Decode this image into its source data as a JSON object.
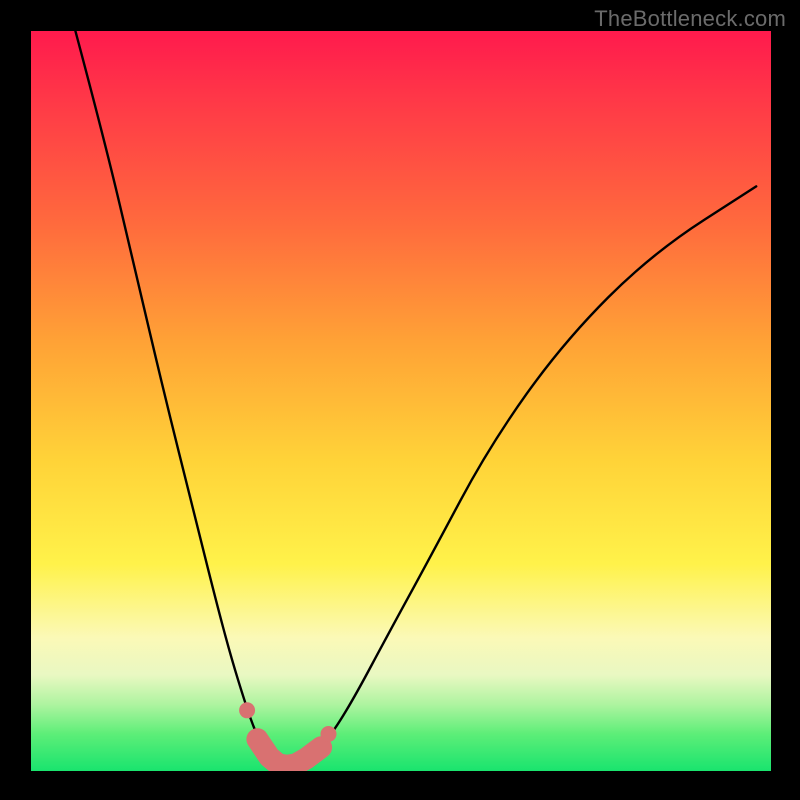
{
  "watermark": "TheBottleneck.com",
  "colors": {
    "frame": "#000000",
    "curve": "#000000",
    "marker_fill": "#d97171",
    "marker_stroke": "#c55f5f",
    "gradient_stops": [
      "#ff1a4d",
      "#ff3a47",
      "#ff6a3d",
      "#ffa236",
      "#ffd338",
      "#fff24a",
      "#fbf9b7",
      "#e9f8c2",
      "#aef4a0",
      "#5dee78",
      "#19e46e"
    ]
  },
  "chart_data": {
    "type": "line",
    "title": "",
    "xlabel": "",
    "ylabel": "",
    "xlim": [
      0,
      100
    ],
    "ylim": [
      0,
      100
    ],
    "grid": false,
    "legend": "none",
    "series": [
      {
        "name": "bottleneck-curve",
        "x": [
          6,
          10,
          14,
          18,
          22,
          25,
          27,
          29,
          30.5,
          32,
          33,
          34,
          35,
          36.5,
          38.5,
          41,
          44,
          48,
          54,
          62,
          72,
          84,
          98
        ],
        "values": [
          100,
          85,
          68,
          51,
          35,
          23,
          15.5,
          9,
          4.8,
          2.2,
          1.0,
          0.6,
          0.6,
          1.0,
          2.4,
          5.5,
          10.5,
          18,
          29,
          44,
          58,
          70,
          79
        ]
      }
    ],
    "markers": {
      "name": "highlight-points",
      "x": [
        29.2,
        30.6,
        32.2,
        33.4,
        34.6,
        35.8,
        37.2,
        39.2,
        40.2
      ],
      "values": [
        8.2,
        4.3,
        1.9,
        0.9,
        0.7,
        0.9,
        1.7,
        3.2,
        5.0
      ],
      "style": "thick-rounded"
    }
  }
}
